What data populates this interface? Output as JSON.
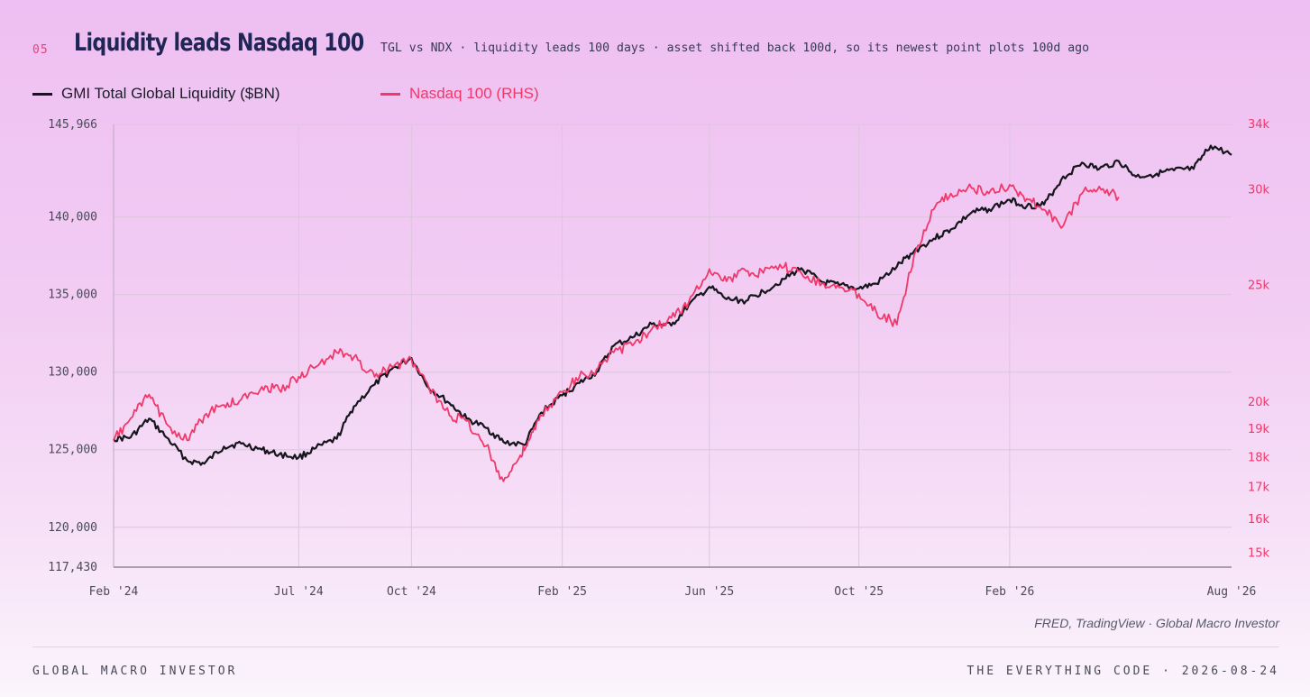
{
  "header": {
    "number": "05",
    "title": "Liquidity leads Nasdaq 100",
    "subtitle": "TGL vs NDX · liquidity leads 100 days · asset shifted back 100d, so its newest point plots 100d ago"
  },
  "colors": {
    "liquidity": "#15151c",
    "nasdaq": "#f0386a",
    "grid": "#dcc6df",
    "axis_text": "#4a4a5a"
  },
  "chart_data": {
    "type": "line",
    "series": [
      {
        "name": "GMI Total Global Liquidity ($BN)",
        "axis": "left",
        "color": "#15151c",
        "x": [
          "2024-02-01",
          "2024-02-15",
          "2024-03-01",
          "2024-03-15",
          "2024-04-01",
          "2024-04-15",
          "2024-05-01",
          "2024-05-15",
          "2024-06-01",
          "2024-06-15",
          "2024-07-01",
          "2024-07-15",
          "2024-08-01",
          "2024-08-15",
          "2024-09-01",
          "2024-09-15",
          "2024-10-01",
          "2024-10-15",
          "2024-11-01",
          "2024-11-15",
          "2024-12-01",
          "2024-12-15",
          "2025-01-01",
          "2025-01-15",
          "2025-02-01",
          "2025-02-15",
          "2025-03-01",
          "2025-03-15",
          "2025-04-01",
          "2025-04-15",
          "2025-05-01",
          "2025-05-15",
          "2025-06-01",
          "2025-06-15",
          "2025-07-01",
          "2025-07-15",
          "2025-08-01",
          "2025-08-15",
          "2025-09-01",
          "2025-09-15",
          "2025-10-01",
          "2025-10-15",
          "2025-11-01",
          "2025-11-15",
          "2025-12-01",
          "2025-12-15",
          "2026-01-01",
          "2026-01-15",
          "2026-02-01",
          "2026-02-15",
          "2026-03-01",
          "2026-03-15",
          "2026-04-01",
          "2026-04-15",
          "2026-05-01",
          "2026-05-15",
          "2026-06-01",
          "2026-06-15",
          "2026-07-01",
          "2026-07-15",
          "2026-08-01"
        ],
        "values": [
          125700,
          125800,
          127000,
          125800,
          124300,
          124100,
          125200,
          125400,
          125000,
          124700,
          124500,
          125100,
          125700,
          127800,
          129200,
          130200,
          130900,
          129000,
          128000,
          127000,
          126400,
          125500,
          125300,
          127400,
          128500,
          129300,
          130000,
          131700,
          132300,
          133100,
          133000,
          134300,
          135500,
          134700,
          134600,
          135200,
          136000,
          136700,
          135800,
          135600,
          135400,
          135700,
          136800,
          137800,
          138600,
          139200,
          140300,
          140500,
          141100,
          140700,
          140800,
          142400,
          143500,
          143100,
          143600,
          142600,
          142800,
          143000,
          143100,
          144600,
          144000
        ]
      },
      {
        "name": "Nasdaq 100 (RHS)",
        "axis": "right",
        "color": "#f0386a",
        "x": [
          "2024-02-01",
          "2024-02-15",
          "2024-03-01",
          "2024-03-15",
          "2024-04-01",
          "2024-04-15",
          "2024-05-01",
          "2024-05-15",
          "2024-06-01",
          "2024-06-15",
          "2024-07-01",
          "2024-07-15",
          "2024-08-01",
          "2024-08-15",
          "2024-09-01",
          "2024-09-15",
          "2024-10-01",
          "2024-10-15",
          "2024-11-01",
          "2024-11-15",
          "2024-12-01",
          "2024-12-15",
          "2024-12-28",
          "2025-01-05",
          "2025-01-15",
          "2025-02-01",
          "2025-02-15",
          "2025-03-01",
          "2025-03-15",
          "2025-04-01",
          "2025-04-15",
          "2025-05-01",
          "2025-05-15",
          "2025-06-01",
          "2025-06-15",
          "2025-07-01",
          "2025-07-15",
          "2025-08-01",
          "2025-08-15",
          "2025-09-01",
          "2025-09-15",
          "2025-10-01",
          "2025-10-15",
          "2025-11-01",
          "2025-11-15",
          "2025-12-01",
          "2025-12-15",
          "2026-01-01",
          "2026-01-15",
          "2026-02-01",
          "2026-02-15",
          "2026-03-01",
          "2026-03-15",
          "2026-04-01",
          "2026-04-15",
          "2026-05-01"
        ],
        "values": [
          18600,
          19400,
          20300,
          19200,
          18600,
          19500,
          19900,
          20100,
          20600,
          20500,
          21000,
          21400,
          22000,
          21800,
          21000,
          21400,
          21700,
          20600,
          19500,
          19300,
          18400,
          17200,
          18000,
          18600,
          19500,
          20400,
          21000,
          21300,
          22000,
          22400,
          23000,
          23500,
          24200,
          25800,
          25200,
          25700,
          25600,
          25900,
          25600,
          25100,
          24900,
          24600,
          23800,
          23200,
          26500,
          28900,
          29800,
          30100,
          29800,
          30300,
          29500,
          28900,
          27900,
          29800,
          30200,
          29600
        ]
      }
    ],
    "y_left": {
      "ylim": [
        117430,
        145966
      ],
      "ticks": [
        117430,
        120000,
        125000,
        130000,
        135000,
        140000,
        145966
      ],
      "tick_labels": [
        "117,430",
        "120,000",
        "125,000",
        "130,000",
        "135,000",
        "140,000",
        "145,966"
      ]
    },
    "y_right": {
      "scale": "log",
      "ylim": [
        14600,
        34000
      ],
      "ticks": [
        15000,
        16000,
        17000,
        18000,
        19000,
        20000,
        25000,
        30000,
        34000
      ],
      "tick_labels": [
        "15k",
        "16k",
        "17k",
        "18k",
        "19k",
        "20k",
        "25k",
        "30k",
        "34k"
      ]
    },
    "x_axis": {
      "range": [
        "2024-02-01",
        "2026-08-01"
      ],
      "ticks": [
        "2024-02-01",
        "2024-07-01",
        "2024-10-01",
        "2025-02-01",
        "2025-06-01",
        "2025-10-01",
        "2026-02-01",
        "2026-08-01"
      ],
      "tick_labels": [
        "Feb '24",
        "Jul '24",
        "Oct '24",
        "Feb '25",
        "Jun '25",
        "Oct '25",
        "Feb '26",
        "Aug '26"
      ]
    },
    "grid": true,
    "legend_placement": "top-left"
  },
  "legend": [
    {
      "label": "GMI Total Global Liquidity ($BN)",
      "color": "#15151c"
    },
    {
      "label": "Nasdaq 100 (RHS)",
      "color": "#f0386a"
    }
  ],
  "source": "FRED, TradingView · Global Macro Investor",
  "footer": {
    "left": "GLOBAL MACRO INVESTOR",
    "right": "THE EVERYTHING CODE · 2026-08-24"
  }
}
